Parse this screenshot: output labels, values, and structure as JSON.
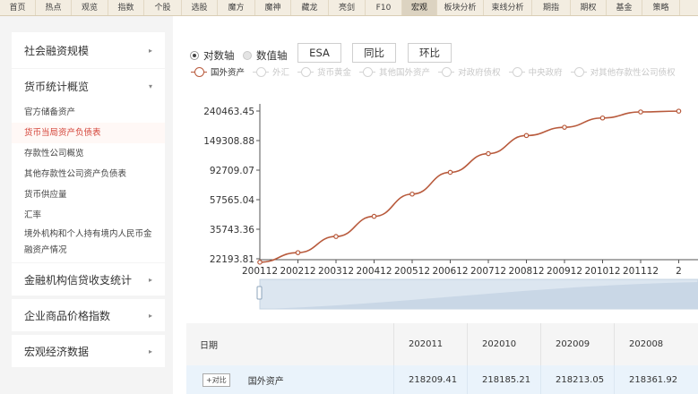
{
  "topnav": {
    "tabs": [
      "首页",
      "热点",
      "观览",
      "指数",
      "个股",
      "选股",
      "魔方",
      "魔神",
      "藏龙",
      "亮剑",
      "F10",
      "宏观",
      "板块分析",
      "束线分析",
      "期指",
      "期权",
      "基金",
      "策略"
    ],
    "active_index": 11
  },
  "sidebar": {
    "sections": [
      {
        "label": "社会融资规模",
        "expanded": false
      },
      {
        "label": "货币统计概览",
        "expanded": true,
        "items": [
          "官方储备资产",
          "货币当局资产负债表",
          "存款性公司概览",
          "其他存款性公司资产负债表",
          "货币供应量",
          "汇率",
          "境外机构和个人持有境内人民币金",
          "融资产情况"
        ],
        "active_item_index": 1
      },
      {
        "label": "金融机构信贷收支统计",
        "expanded": false
      },
      {
        "label": "企业商品价格指数",
        "expanded": false
      },
      {
        "label": "宏观经济数据",
        "expanded": false
      }
    ]
  },
  "controls": {
    "log_axis_label": "对数轴",
    "value_axis_label": "数值轴",
    "log_axis_selected": true,
    "btn_esa": "ESA",
    "btn_yoy": "同比",
    "btn_mom": "环比"
  },
  "legend": [
    {
      "label": "国外资产",
      "active": true
    },
    {
      "label": "外汇",
      "active": false
    },
    {
      "label": "货币黄金",
      "active": false
    },
    {
      "label": "其他国外资产",
      "active": false
    },
    {
      "label": "对政府债权",
      "active": false
    },
    {
      "label": "中央政府",
      "active": false
    },
    {
      "label": "对其他存款性公司债权",
      "active": false
    }
  ],
  "colors": {
    "line": "#b85a3c",
    "accent": "#d4453a",
    "nav_bg": "#f3ede1",
    "sidebar_bg": "#f4f4f4",
    "table_row": "#eaf3fb"
  },
  "chart_data": {
    "type": "line",
    "y_scale": "log",
    "y_ticks": [
      22193.81,
      35743.36,
      57565.04,
      92709.07,
      149308.88,
      240463.45
    ],
    "y_tick_labels": [
      "22193.81",
      "35743.36",
      "57565.04",
      "92709.07",
      "149308.88",
      "240463.45"
    ],
    "x_tick_labels": [
      "200112",
      "200212",
      "200312",
      "200412",
      "200512",
      "200612",
      "200712",
      "200812",
      "200912",
      "201012",
      "201112",
      "2"
    ],
    "series": [
      {
        "name": "国外资产",
        "color": "#b85a3c",
        "points": [
          [
            "200112",
            21000
          ],
          [
            "200212",
            24500
          ],
          [
            "200312",
            31800
          ],
          [
            "200412",
            44000
          ],
          [
            "200512",
            63000
          ],
          [
            "200612",
            89500
          ],
          [
            "200712",
            121000
          ],
          [
            "200812",
            162000
          ],
          [
            "200912",
            185000
          ],
          [
            "201012",
            215000
          ],
          [
            "201112",
            237000
          ],
          [
            "201212",
            240000
          ]
        ]
      }
    ]
  },
  "table": {
    "header_label": "日期",
    "columns": [
      "202011",
      "202010",
      "202009",
      "202008"
    ],
    "rows": [
      {
        "compare_label": "+对比",
        "name": "国外资产",
        "values": [
          "218209.41",
          "218185.21",
          "218213.05",
          "218361.92"
        ]
      }
    ]
  }
}
